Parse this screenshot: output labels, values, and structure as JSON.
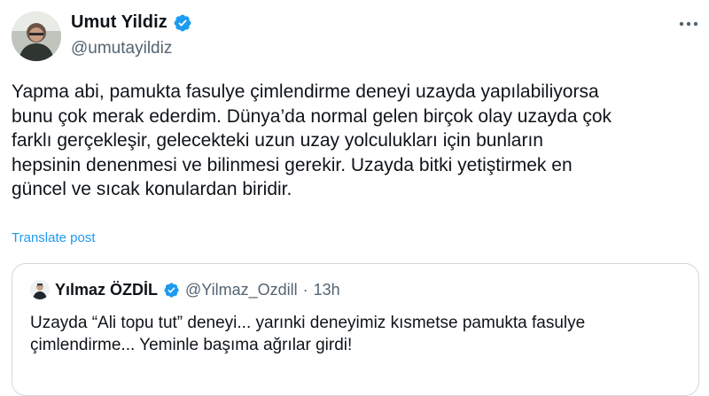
{
  "author": {
    "display_name": "Umut Yildiz",
    "handle": "@umutayildiz",
    "avatar_icon": "profile-photo"
  },
  "tweet": {
    "lines": [
      "Yapma abi, pamukta fasulye çimlendirme deneyi uzayda yapılabiliyorsa",
      "bunu çok merak ederdim. Dünya’da normal gelen birçok olay uzayda çok",
      "farklı gerçekleşir, gelecekteki uzun uzay yolculukları için bunların",
      "hepsinin denenmesi ve bilinmesi gerekir. Uzayda bitki yetiştirmek en",
      "güncel ve sıcak konulardan biridir."
    ],
    "translate_label": "Translate post"
  },
  "quoted": {
    "display_name": "Yılmaz ÖZDİL",
    "handle": "@Yilmaz_Ozdill",
    "separator": "·",
    "time": "13h",
    "lines": [
      "Uzayda “Ali topu tut” deneyi... yarınki deneyimiz kısmetse pamukta fasulye",
      "çimlendirme... Yeminle başıma ağrılar girdi!"
    ]
  },
  "colors": {
    "verified": "#1d9bf0",
    "link": "#1d9bf0",
    "secondary_text": "#536471",
    "border": "#cfd9de"
  }
}
